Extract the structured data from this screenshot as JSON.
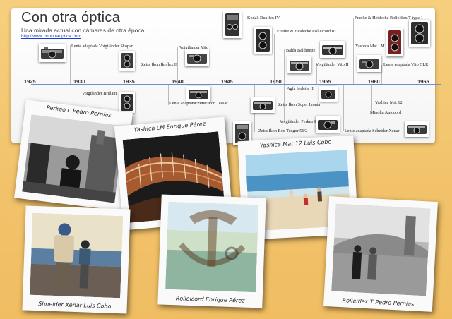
{
  "header": {
    "title": "Con otra óptica",
    "subtitle": "Una mirada actual con cámaras de otra época",
    "url": "http://www.conotraoptica.com"
  },
  "timeline": {
    "years": [
      "1925",
      "1930",
      "1935",
      "1940",
      "1945",
      "1950",
      "1955",
      "1960",
      "1965"
    ],
    "events": {
      "e01": "Lente adaptada Voigtländer Skopar",
      "e02": "Zeiss Ikon Ikoflex II",
      "e03": "Voigtländer Vito I",
      "e04": "Kodak Duaflex IV",
      "e05": "Franke & Heidecke Rolleicord III",
      "e06": "Balda Baldinette",
      "e07": "Voigtländer Vito II",
      "e08": "Franke & Heidecke Rolleiflex T type 1",
      "e09": "Yashica Mat LM",
      "e10": "Lente adaptada Vito CLR",
      "e11": "Voigtländer Brillant",
      "e12": "Lente adaptada Zeiss Ikon Tessar",
      "e13": "Agfa Isolette II",
      "e14": "Zeiss Ikon Super Ikonta",
      "e15": "Voigtländer Perkeo I",
      "e16": "Zeiss Ikon Box Tengor 56/2",
      "e17": "Lente adaptada Scheider Xenar",
      "e18": "Yashica Mat 12",
      "e19": "Minolta Autocord"
    }
  },
  "photos": {
    "p1": "Perkeo I. Pedro Pernías",
    "p2": "Yashica LM Enrique Pérez",
    "p3": "Yashica Mat 12 Luis Cobo",
    "p4": "Shneider Xenar Luis Cobo",
    "p5": "Rolleicord Enrique Pérez",
    "p6": "Rolleiflex T Pedro Pernías"
  },
  "colors": {
    "background": "#f2c36c",
    "axis": "#6b8fcf",
    "url": "#1a3cc8"
  }
}
